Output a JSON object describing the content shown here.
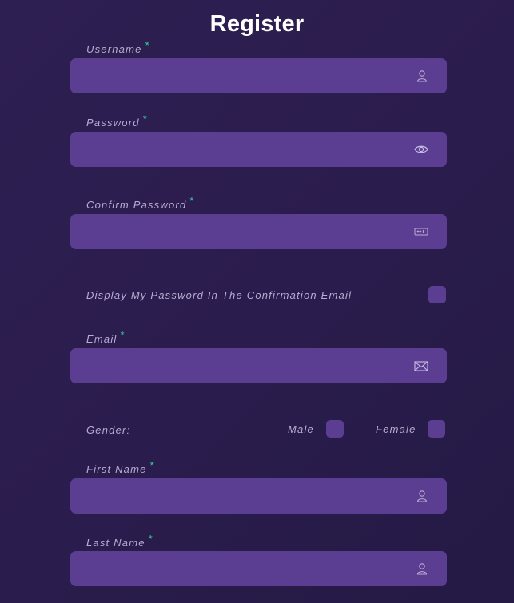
{
  "title": "Register",
  "required_mark": "*",
  "fields": {
    "username": {
      "label": "Username",
      "value": "",
      "icon": "user-icon"
    },
    "password": {
      "label": "Password",
      "value": "",
      "icon": "eye-icon"
    },
    "confirm_password": {
      "label": "Confirm Password",
      "value": "",
      "icon": "password-dots-icon"
    },
    "email": {
      "label": "Email",
      "value": "",
      "icon": "envelope-icon"
    },
    "first_name": {
      "label": "First Name",
      "value": "",
      "icon": "user-icon"
    },
    "last_name": {
      "label": "Last Name",
      "value": "",
      "icon": "user-icon"
    }
  },
  "display_password_email": {
    "label": "Display My Password In The Confirmation Email",
    "checked": false
  },
  "gender": {
    "label": "Gender:",
    "male": "Male",
    "female": "Female"
  },
  "colors": {
    "field_bg": "#5b3e91",
    "accent_required": "#35d7a0",
    "background": "#2b1d4d"
  }
}
